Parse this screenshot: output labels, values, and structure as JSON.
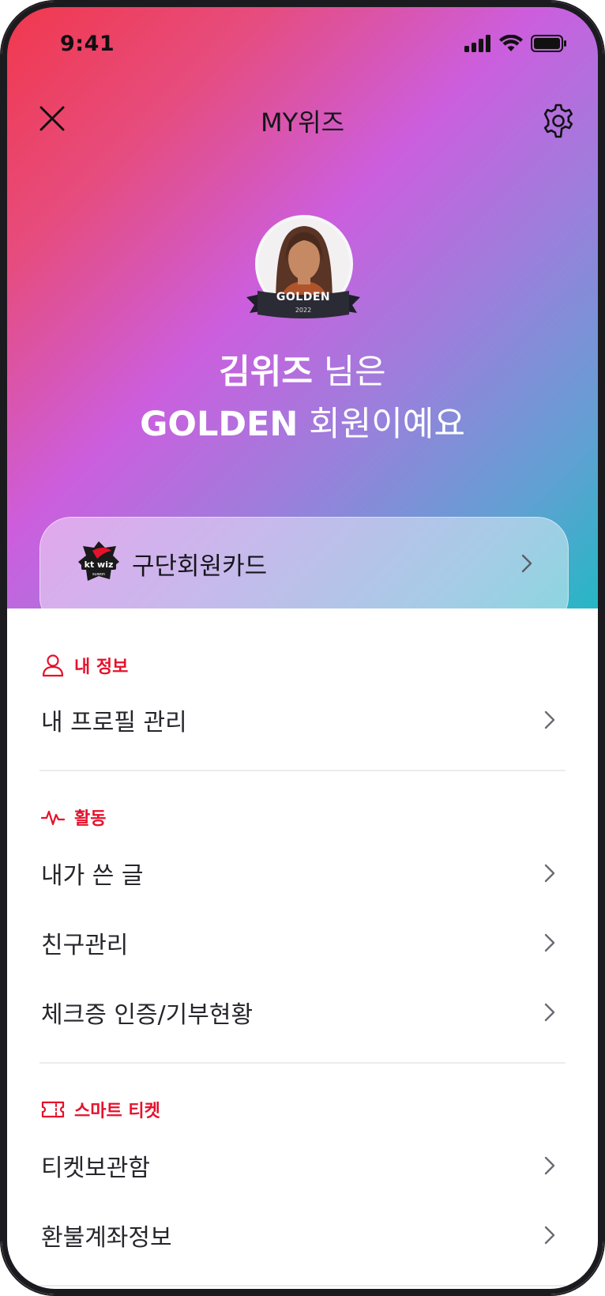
{
  "status_bar": {
    "time": "9:41"
  },
  "header": {
    "title": "MY위즈"
  },
  "profile": {
    "badge": "GOLDEN",
    "badge_year": "2022",
    "name": "김위즈",
    "name_suffix": "님은",
    "grade": "GOLDEN",
    "grade_suffix": "회원이예요"
  },
  "member_card": {
    "label": "구단회원카드",
    "logo_text": "kt wiz",
    "logo_sub": "suwon"
  },
  "sections": {
    "info": {
      "title": "내 정보",
      "items": [
        "내 프로필 관리"
      ]
    },
    "activity": {
      "title": "활동",
      "items": [
        "내가 쓴 글",
        "친구관리",
        "체크증 인증/기부현황"
      ]
    },
    "ticket": {
      "title": "스마트 티켓",
      "items": [
        "티켓보관함",
        "환불계좌정보"
      ]
    }
  },
  "colors": {
    "accent": "#e6112b",
    "text": "#26262c",
    "gradient_start": "#f2374b",
    "gradient_mid": "#cc5ede",
    "gradient_end": "#23b8c4"
  }
}
